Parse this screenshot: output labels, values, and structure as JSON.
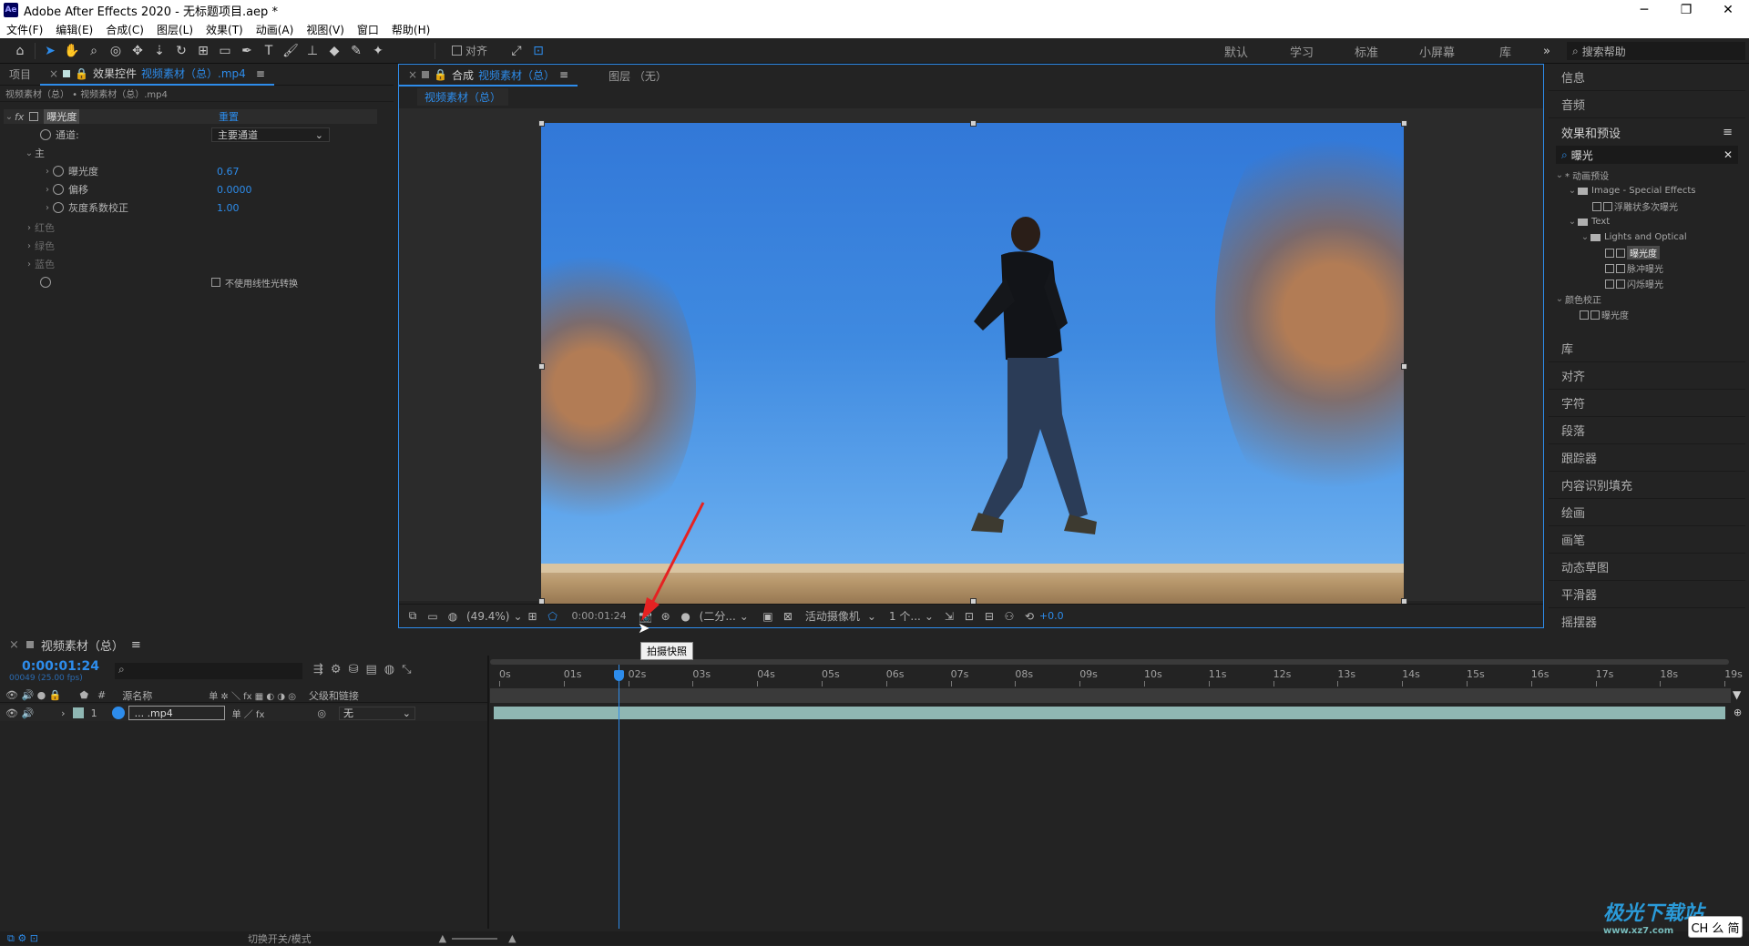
{
  "app": {
    "title": "Adobe After Effects 2020 - 无标题项目.aep *",
    "logo": "Ae"
  },
  "window_controls": [
    "─",
    "❐",
    "✕"
  ],
  "menu": [
    "文件(F)",
    "编辑(E)",
    "合成(C)",
    "图层(L)",
    "效果(T)",
    "动画(A)",
    "视图(V)",
    "窗口",
    "帮助(H)"
  ],
  "toolbar": {
    "align_label": "对齐"
  },
  "workspaces": [
    "默认",
    "学习",
    "标准",
    "小屏幕",
    "库"
  ],
  "search_help": "搜索帮助",
  "left_panel": {
    "tab_project": "项目",
    "tab_effects_prefix": "效果控件",
    "tab_effects_name": "视频素材（总）.mp4",
    "breadcrumb": "视频素材（总） • 视频素材（总）.mp4",
    "effect_name": "曝光度",
    "reset": "重置",
    "channel_label": "通道:",
    "channel_value": "主要通道",
    "master": "主",
    "params": [
      {
        "label": "曝光度",
        "value": "0.67"
      },
      {
        "label": "偏移",
        "value": "0.0000"
      },
      {
        "label": "灰度系数校正",
        "value": "1.00"
      }
    ],
    "sub_groups": [
      "红色",
      "绿色",
      "蓝色"
    ],
    "linear_checkbox": "不使用线性光转换"
  },
  "viewer": {
    "tab_prefix": "合成",
    "tab_name": "视频素材（总）",
    "layer_tab": "图层 （无）",
    "comp_chip": "视频素材（总）",
    "zoom": "(49.4%)",
    "timecode": "0:00:01:24",
    "resolution": "(二分...",
    "camera": "活动摄像机",
    "views": "1 个...",
    "exposure": "+0.0",
    "tooltip": "拍摄快照"
  },
  "right_panel": {
    "top_items": [
      "信息",
      "音频"
    ],
    "effects_title": "效果和预设",
    "search_value": "曝光",
    "tree": [
      {
        "text": "* 动画预设",
        "indent": 0,
        "kind": "root"
      },
      {
        "text": "Image - Special Effects",
        "indent": 1,
        "kind": "folder"
      },
      {
        "text": "浮雕状多次曝光",
        "indent": 2,
        "kind": "fx"
      },
      {
        "text": "Text",
        "indent": 1,
        "kind": "folder"
      },
      {
        "text": "Lights and Optical",
        "indent": 2,
        "kind": "folder"
      },
      {
        "text": "曝光度",
        "indent": 3,
        "kind": "fx",
        "selected": true
      },
      {
        "text": "脉冲曝光",
        "indent": 3,
        "kind": "fx"
      },
      {
        "text": "闪烁曝光",
        "indent": 3,
        "kind": "fx"
      },
      {
        "text": "颜色校正",
        "indent": 0,
        "kind": "root"
      },
      {
        "text": "曝光度",
        "indent": 1,
        "kind": "fx"
      }
    ],
    "bottom_items": [
      "库",
      "对齐",
      "字符",
      "段落",
      "跟踪器",
      "内容识别填充",
      "绘画",
      "画笔",
      "动态草图",
      "平滑器",
      "摇摆器"
    ]
  },
  "timeline": {
    "tab": "视频素材（总）",
    "timecode": "0:00:01:24",
    "frame_info": "00049 (25.00 fps)",
    "col_source": "源名称",
    "col_parent": "父级和链接",
    "layer_num": "1",
    "layer_name": "... .mp4",
    "parent_value": "无",
    "ruler": [
      "0s",
      "01s",
      "02s",
      "03s",
      "04s",
      "05s",
      "06s",
      "07s",
      "08s",
      "09s",
      "10s",
      "11s",
      "12s",
      "13s",
      "14s",
      "15s",
      "16s",
      "17s",
      "18s",
      "19s"
    ]
  },
  "status": {
    "toggle": "切换开关/模式"
  },
  "watermark": {
    "name": "极光下载站",
    "url": "www.xz7.com"
  },
  "ime": "CH 么 简",
  "colors": {
    "accent": "#2d8ceb",
    "panel": "#232323",
    "layer_bar": "#8fb7b3"
  }
}
